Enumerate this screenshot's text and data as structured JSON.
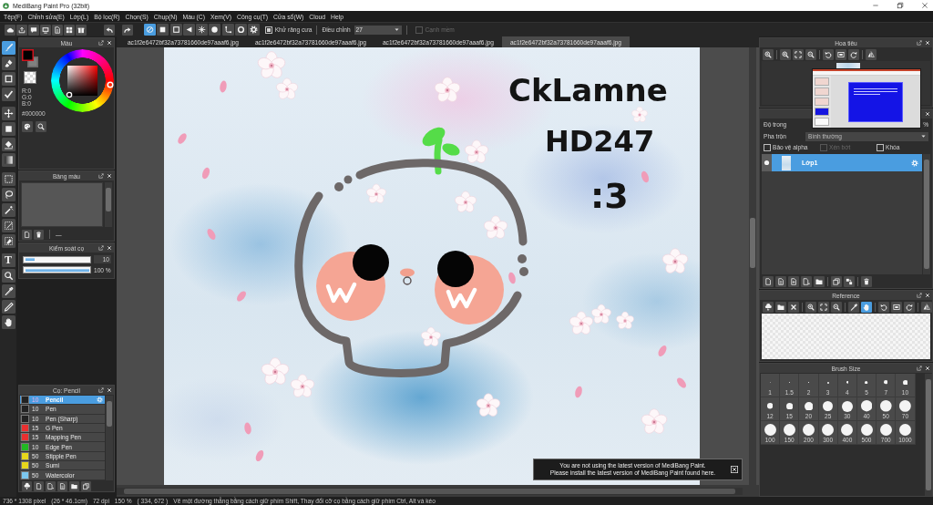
{
  "window": {
    "title": "MediBang Paint Pro (32bit)"
  },
  "menu": [
    "Tệp(F)",
    "Chỉnh sửa(E)",
    "Lớp(L)",
    "Bộ lọc(R)",
    "Chọn(S)",
    "Chụp(N)",
    "Màu (C)",
    "Xem(V)",
    "Công cụ(T)",
    "Cửa sổ(W)",
    "Cloud",
    "Help"
  ],
  "toolbar": {
    "modes": [
      {
        "selected": true
      },
      {
        "selected": false
      },
      {
        "selected": false
      },
      {
        "selected": false
      },
      {
        "selected": false
      },
      {
        "selected": false
      },
      {
        "selected": false
      },
      {
        "selected": false
      },
      {
        "selected": false
      }
    ],
    "antialias": {
      "label": "Khử răng cưa",
      "checked": true
    },
    "adjust": {
      "label": "Điều chỉnh",
      "value": "27"
    },
    "soft_edge": {
      "label": "Cạnh mềm",
      "checked": false,
      "disabled": true
    }
  },
  "tools": [
    {
      "selected": true
    },
    {
      "selected": false
    },
    {
      "selected": false
    },
    {
      "selected": false
    },
    {
      "selected": false
    },
    {
      "selected": false
    },
    {
      "selected": false
    },
    {
      "selected": false
    },
    {
      "selected": false
    },
    {
      "selected": false
    },
    {
      "selected": false
    },
    {
      "selected": false
    },
    {
      "selected": false
    },
    {
      "selected": false,
      "glyph": "T"
    },
    {
      "selected": false
    },
    {
      "selected": false
    },
    {
      "selected": false
    },
    {
      "selected": false
    }
  ],
  "color_panel": {
    "title": "Màu",
    "foreground": {
      "color": "#000000",
      "selected": true
    },
    "background": {
      "color": "#808080",
      "selected": false
    },
    "channels": [
      "R:0",
      "G:0",
      "B:0"
    ],
    "hex": "#000000"
  },
  "palette_panel": {
    "title": "Bảng màu",
    "selector": "—"
  },
  "brush_control": {
    "title": "Kiểm soát cọ",
    "size": {
      "level": 0.15,
      "value": "10"
    },
    "opacity": {
      "level": 1,
      "value": "100 %"
    }
  },
  "brush_panel": {
    "title": "Cọ: Pencil",
    "brushes": [
      {
        "size": "10",
        "name": "Pencil",
        "color": "#222222",
        "selected": true
      },
      {
        "size": "10",
        "name": "Pen",
        "color": "#222222",
        "selected": false
      },
      {
        "size": "10",
        "name": "Pen (Sharp)",
        "color": "#222222",
        "selected": false
      },
      {
        "size": "15",
        "name": "G Pen",
        "color": "#e83030",
        "selected": false
      },
      {
        "size": "15",
        "name": "Mapping Pen",
        "color": "#e83030",
        "selected": false
      },
      {
        "size": "10",
        "name": "Edge Pen",
        "color": "#22b822",
        "selected": false
      },
      {
        "size": "50",
        "name": "Stipple Pen",
        "color": "#e8d81c",
        "selected": false
      },
      {
        "size": "50",
        "name": "Sumi",
        "color": "#e8d81c",
        "selected": false
      },
      {
        "size": "50",
        "name": "Watercolor",
        "color": "#7cc8f0",
        "selected": false
      }
    ]
  },
  "tabs": [
    {
      "label": "ac1f2e6472bf32a73781660de97aaaf6.jpg",
      "selected": false
    },
    {
      "label": "ac1f2e6472bf32a73781660de97aaaf6.jpg",
      "selected": false
    },
    {
      "label": "ac1f2e6472bf32a73781660de97aaaf6.jpg",
      "selected": false
    },
    {
      "label": "ac1f2e6472bf32a73781660de97aaaf6.jpg",
      "selected": true
    }
  ],
  "canvas": {
    "handwriting": [
      "CkLamne",
      "HD247",
      ":3"
    ]
  },
  "notice": {
    "lines": [
      "You are not using the latest version of MediBang Paint.",
      "Please install the latest version of MediBang Paint found here."
    ]
  },
  "navigator": {
    "title": "Hoa tiêu"
  },
  "layers": {
    "opacity_label": "Độ trong",
    "opacity_unit": "%",
    "blend_label": "Pha trộn",
    "blend_mode": "Bình thường",
    "options": [
      {
        "label": "Bảo vệ alpha",
        "checked": false,
        "disabled": false
      },
      {
        "label": "Xén bớt",
        "checked": false,
        "disabled": true
      },
      {
        "label": "Khóa",
        "checked": false,
        "disabled": false
      }
    ],
    "items": [
      {
        "name": "Lớp1",
        "visible": true,
        "selected": true
      }
    ]
  },
  "reference": {
    "title": "Reference",
    "modes": [
      {
        "selected": false
      },
      {
        "selected": true
      }
    ]
  },
  "brush_size": {
    "title": "Brush Size",
    "sizes": [
      "1",
      "1.5",
      "2",
      "3",
      "4",
      "5",
      "7",
      "10",
      "12",
      "15",
      "20",
      "25",
      "30",
      "40",
      "50",
      "70",
      "100",
      "150",
      "200",
      "300",
      "400",
      "500",
      "700",
      "1000"
    ]
  },
  "status_bar": [
    "736 * 1308 pixel",
    "(26 * 46.1cm)",
    "72 dpi",
    "150 %",
    "( 334, 672 )",
    "Vẽ một đường thẳng bằng cách giữ phím Shift, Thay đổi cỡ cọ bằng cách giữ phím Ctrl, Alt và kéo"
  ]
}
